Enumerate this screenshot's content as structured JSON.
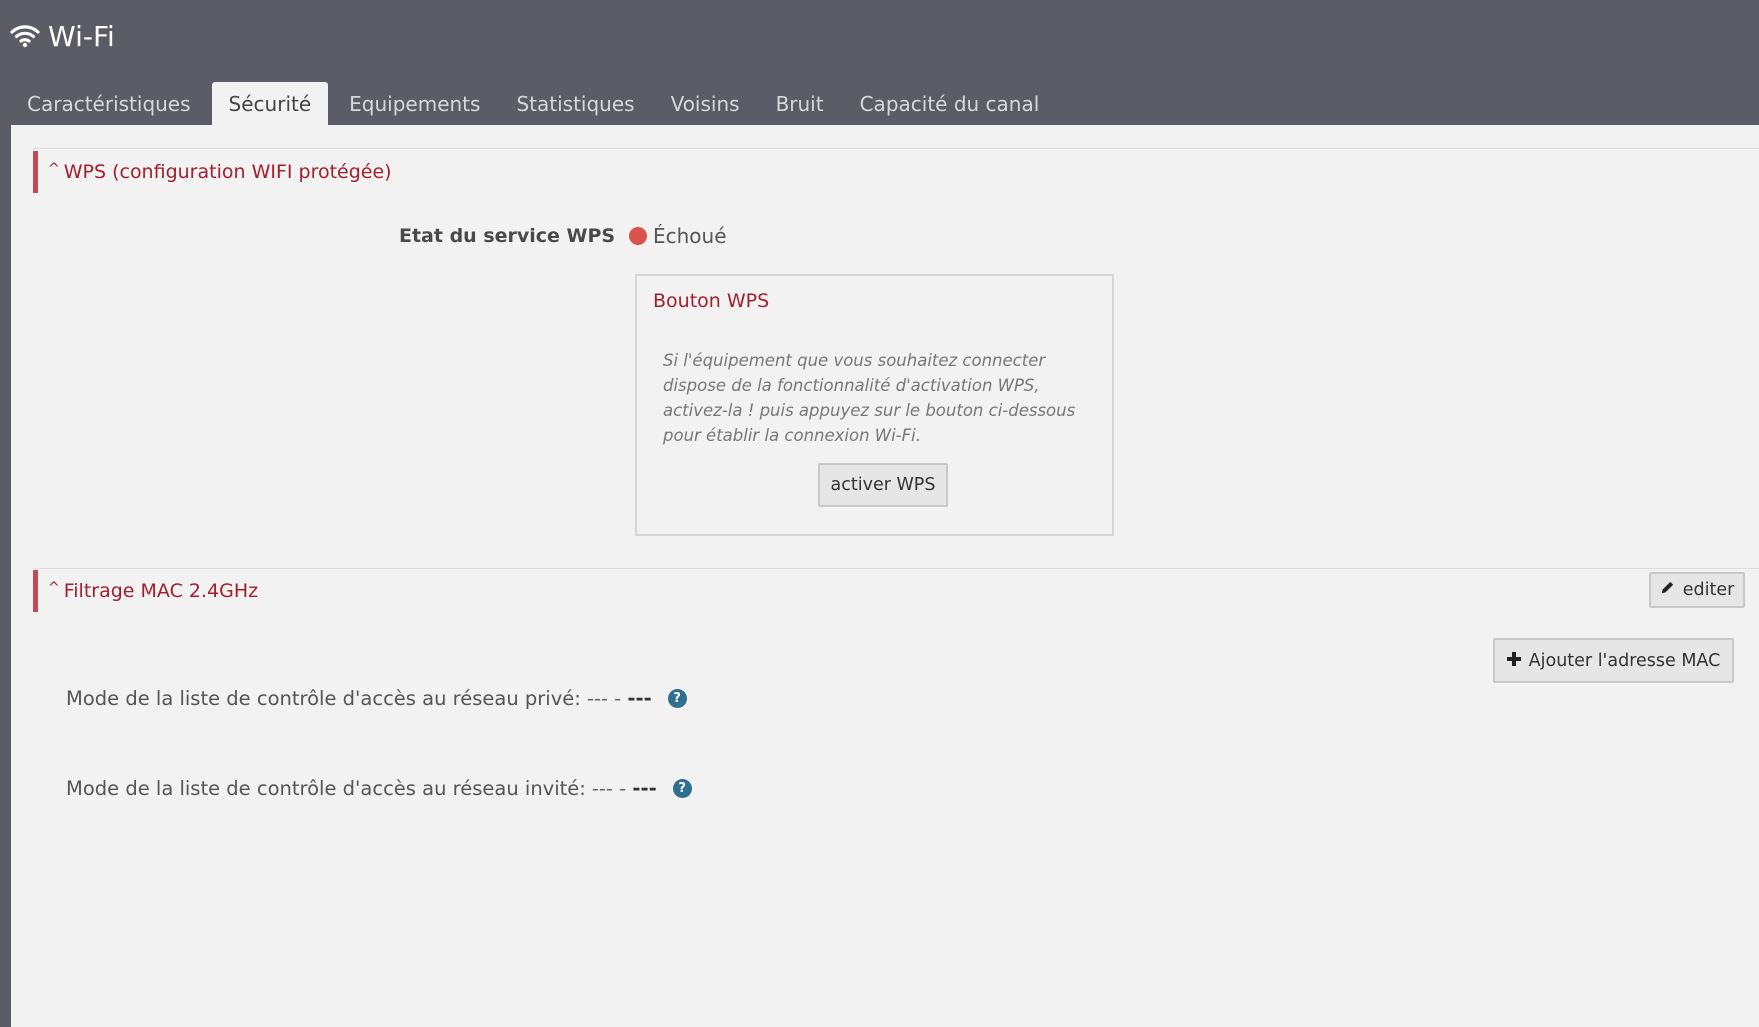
{
  "header": {
    "title": "Wi-Fi",
    "icon": "wifi-icon"
  },
  "tabs": [
    {
      "label": "Caractéristiques",
      "active": false
    },
    {
      "label": "Sécurité",
      "active": true
    },
    {
      "label": "Equipements",
      "active": false
    },
    {
      "label": "Statistiques",
      "active": false
    },
    {
      "label": "Voisins",
      "active": false
    },
    {
      "label": "Bruit",
      "active": false
    },
    {
      "label": "Capacité du canal",
      "active": false
    }
  ],
  "wps": {
    "section_title": "WPS (configuration WIFI protégée)",
    "service_label": "Etat du service WPS",
    "status_text": "Échoué",
    "status_color": "#d9534f",
    "box_title": "Bouton WPS",
    "box_description": "Si l'équipement que vous souhaitez connecter dispose de la fonctionnalité d'activation WPS, activez-la ! puis appuyez sur le bouton ci-dessous pour établir la connexion Wi-Fi.",
    "activate_button": "activer WPS"
  },
  "mac_filter": {
    "section_title": "Filtrage MAC 2.4GHz",
    "edit_button": "editer",
    "add_button": "Ajouter l'adresse MAC",
    "private_label": "Mode de la liste de contrôle d'accès au réseau privé:",
    "private_value_prefix": "--- -",
    "private_value": "---",
    "guest_label": "Mode de la liste de contrôle d'accès au réseau invité:",
    "guest_value_prefix": "--- -",
    "guest_value": "---",
    "help_glyph": "?"
  },
  "colors": {
    "accent": "#a11f2e",
    "header_bg": "#5b5c66",
    "panel_bg": "#f2f2f2",
    "help_icon": "#2f6f8f"
  }
}
